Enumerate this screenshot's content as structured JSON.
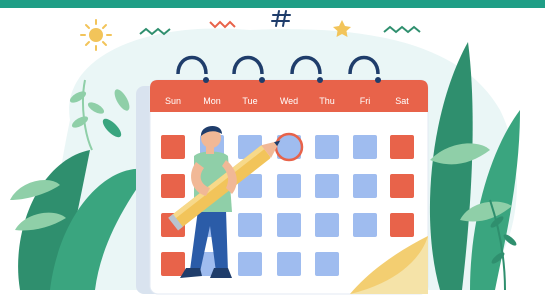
{
  "illustration": {
    "subject": "calendar-planning",
    "calendar": {
      "weekdays": [
        "Sun",
        "Mon",
        "Tue",
        "Wed",
        "Thu",
        "Fri",
        "Sat"
      ]
    },
    "colors": {
      "top_bar": "#1f9e86",
      "calendar_header": "#e8634a",
      "weekend_cell": "#e8634a",
      "weekday_cell": "#9fbcef",
      "leaf_dark": "#2f8f6e",
      "leaf_light": "#8fcfa8",
      "pencil": "#f2c45a",
      "background_blob": "#eaf6f6"
    }
  }
}
